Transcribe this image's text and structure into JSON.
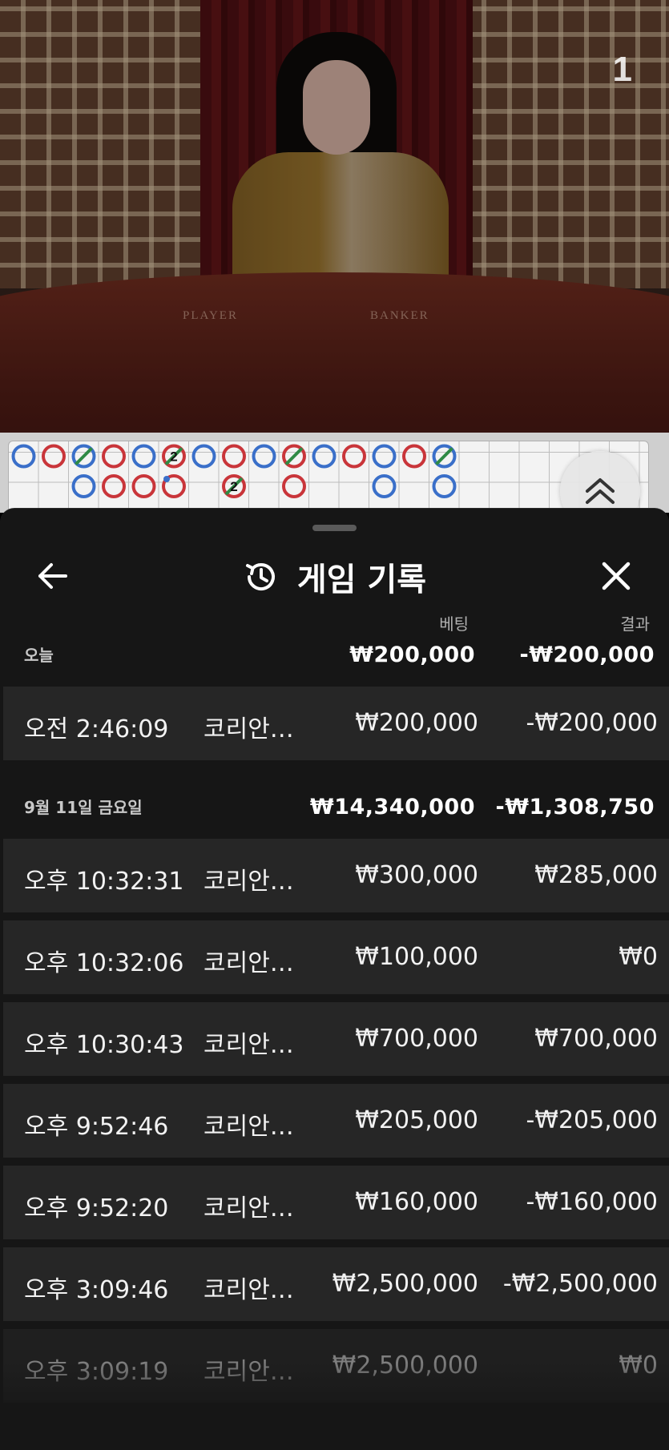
{
  "video": {
    "round_number": "1",
    "table_label_player": "PLAYER",
    "table_label_banker": "BANKER"
  },
  "bead_road": {
    "colors": {
      "blue": "#3a6fc9",
      "red": "#c9353a",
      "tie_green": "#2f8a45"
    },
    "columns": [
      [
        {
          "c": "blue"
        }
      ],
      [
        {
          "c": "red"
        }
      ],
      [
        {
          "c": "blue",
          "tie": true
        },
        {
          "c": "blue"
        }
      ],
      [
        {
          "c": "red"
        },
        {
          "c": "red"
        }
      ],
      [
        {
          "c": "blue"
        },
        {
          "c": "red"
        }
      ],
      [
        {
          "c": "red",
          "tie": true,
          "n": "2"
        },
        {
          "c": "red",
          "dot": true
        }
      ],
      [
        {
          "c": "blue"
        }
      ],
      [
        {
          "c": "red"
        },
        {
          "c": "red",
          "tie": true,
          "n": "2"
        }
      ],
      [
        {
          "c": "blue"
        }
      ],
      [
        {
          "c": "red",
          "tie": true
        },
        {
          "c": "red"
        }
      ],
      [
        {
          "c": "blue"
        }
      ],
      [
        {
          "c": "red"
        }
      ],
      [
        {
          "c": "blue"
        },
        {
          "c": "blue"
        }
      ],
      [
        {
          "c": "red"
        }
      ],
      [
        {
          "c": "blue",
          "tie": true
        },
        {
          "c": "blue"
        }
      ]
    ]
  },
  "sheet": {
    "title": "게임 기록",
    "col_bet": "베팅",
    "col_result": "결과",
    "groups": [
      {
        "date": "오늘",
        "bet_total": "₩200,000",
        "result_total": "-₩200,000",
        "rows": [
          {
            "time": "오전 2:46:09",
            "game": "코리안…",
            "bet": "₩200,000",
            "result": "-₩200,000"
          }
        ]
      },
      {
        "date": "9월 11일 금요일",
        "bet_total": "₩14,340,000",
        "result_total": "-₩1,308,750",
        "rows": [
          {
            "time": "오후 10:32:31",
            "game": "코리안…",
            "bet": "₩300,000",
            "result": "₩285,000"
          },
          {
            "time": "오후 10:32:06",
            "game": "코리안…",
            "bet": "₩100,000",
            "result": "₩0"
          },
          {
            "time": "오후 10:30:43",
            "game": "코리안…",
            "bet": "₩700,000",
            "result": "₩700,000"
          },
          {
            "time": "오후 9:52:46",
            "game": "코리안…",
            "bet": "₩205,000",
            "result": "-₩205,000"
          },
          {
            "time": "오후 9:52:20",
            "game": "코리안…",
            "bet": "₩160,000",
            "result": "-₩160,000"
          },
          {
            "time": "오후 3:09:46",
            "game": "코리안…",
            "bet": "₩2,500,000",
            "result": "-₩2,500,000"
          },
          {
            "time": "오후 3:09:19",
            "game": "코리안…",
            "bet": "₩2,500,000",
            "result": "₩0"
          }
        ]
      }
    ]
  }
}
